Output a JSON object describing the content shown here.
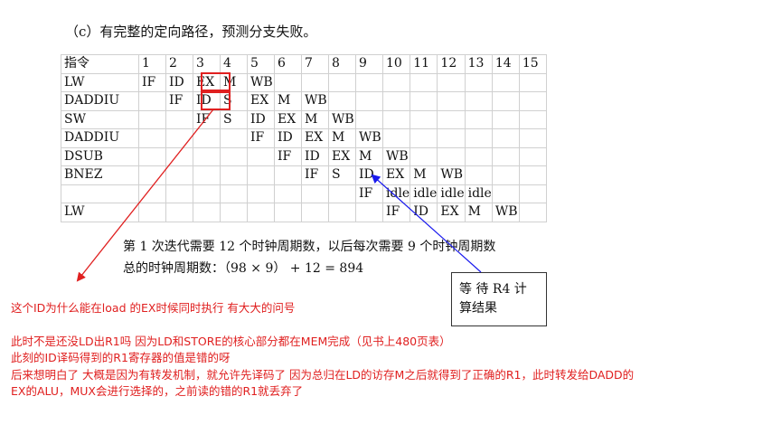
{
  "heading": "（c）有完整的定向路径，预测分支失败。",
  "table": {
    "header": [
      "指令",
      "1",
      "2",
      "3",
      "4",
      "5",
      "6",
      "7",
      "8",
      "9",
      "10",
      "11",
      "12",
      "13",
      "14",
      "15"
    ],
    "rows": [
      [
        "LW",
        "IF",
        "ID",
        "EX",
        "M",
        "WB",
        "",
        "",
        "",
        "",
        "",
        "",
        "",
        "",
        "",
        ""
      ],
      [
        "DADDIU",
        "",
        "IF",
        "ID",
        "S",
        "EX",
        "M",
        "WB",
        "",
        "",
        "",
        "",
        "",
        "",
        "",
        ""
      ],
      [
        "SW",
        "",
        "",
        "IF",
        "S",
        "ID",
        "EX",
        "M",
        "WB",
        "",
        "",
        "",
        "",
        "",
        "",
        ""
      ],
      [
        "DADDIU",
        "",
        "",
        "",
        "",
        "IF",
        "ID",
        "EX",
        "M",
        "WB",
        "",
        "",
        "",
        "",
        "",
        ""
      ],
      [
        "DSUB",
        "",
        "",
        "",
        "",
        "",
        "IF",
        "ID",
        "EX",
        "M",
        "WB",
        "",
        "",
        "",
        "",
        ""
      ],
      [
        "BNEZ",
        "",
        "",
        "",
        "",
        "",
        "",
        "IF",
        "S",
        "ID",
        "EX",
        "M",
        "WB",
        "",
        "",
        ""
      ],
      [
        "",
        "",
        "",
        "",
        "",
        "",
        "",
        "",
        "",
        "IF",
        "idle",
        "idle",
        "idle",
        "idle",
        "",
        ""
      ],
      [
        "LW",
        "",
        "",
        "",
        "",
        "",
        "",
        "",
        "",
        "",
        "IF",
        "ID",
        "EX",
        "M",
        "WB",
        ""
      ]
    ]
  },
  "summary": {
    "line1": "第 1 次迭代需要 12 个时钟周期数，以后每次需要 9 个时钟周期数",
    "line2": "总的时钟周期数：（98 × 9）  + 12 = 894"
  },
  "callout": {
    "line1": "等 待  R4  计",
    "line2": "算结果"
  },
  "notes": {
    "question": "这个ID为什么能在load 的EX时候同时执行 有大大的问号",
    "line1": "此时不是还没LD出R1吗 因为LD和STORE的核心部分都在MEM完成（见书上480页表）",
    "line2": "此刻的ID译码得到的R1寄存器的值是错的呀",
    "line3": "后来想明白了 大概是因为有转发机制，就允许先译码了 因为总归在LD的访存M之后就得到了正确的R1，此时转发给DADD的",
    "line4": "EX的ALU，MUX会进行选择的，之前读的错的R1就丢弃了"
  },
  "colors": {
    "red": "#e02020",
    "blue": "#1a1aee",
    "grid": "#d0d0d0"
  }
}
